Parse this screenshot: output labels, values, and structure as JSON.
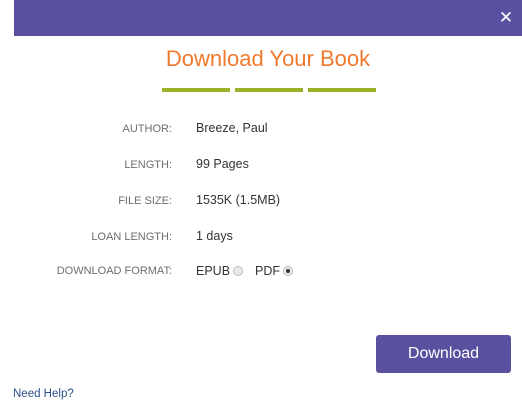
{
  "dialog": {
    "close_glyph": "✕",
    "title": "Download Your Book"
  },
  "details": {
    "author": {
      "label": "AUTHOR:",
      "value": "Breeze, Paul"
    },
    "length": {
      "label": "LENGTH:",
      "value": "99 Pages"
    },
    "file_size": {
      "label": "FILE SIZE:",
      "value": "1535K (1.5MB)"
    },
    "loan_length": {
      "label": "LOAN LENGTH:",
      "value": "1 days"
    },
    "format": {
      "label": "DOWNLOAD FORMAT:",
      "options": [
        {
          "label": "EPUB",
          "selected": false
        },
        {
          "label": "PDF",
          "selected": true
        }
      ]
    }
  },
  "actions": {
    "download_label": "Download",
    "help_label": "Need Help?"
  },
  "colors": {
    "brand": "#5a50a0",
    "title": "#ef7a2e",
    "accent": "#9ab22a"
  }
}
